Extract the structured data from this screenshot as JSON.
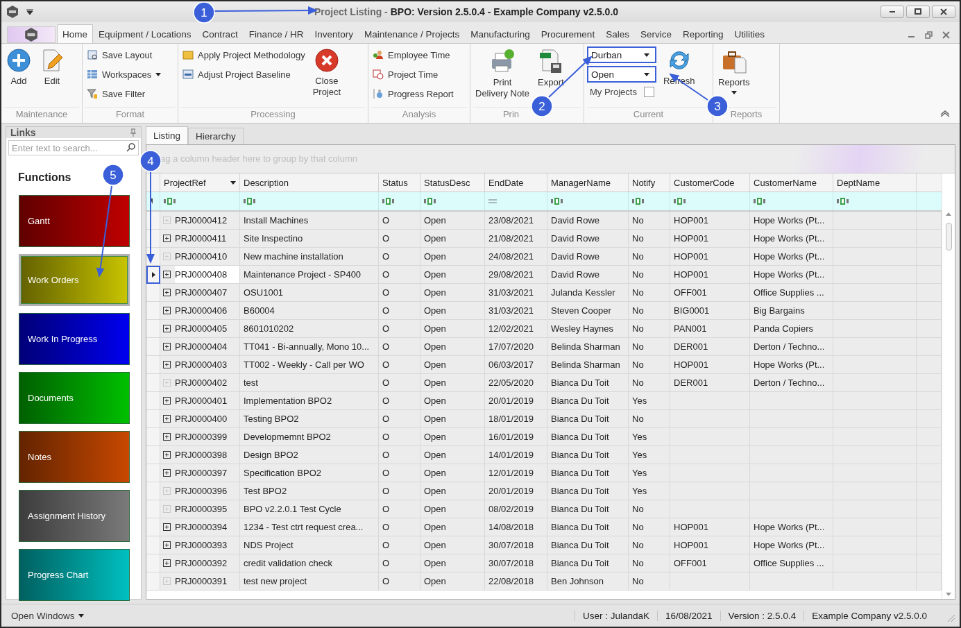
{
  "window": {
    "title": "Project Listing - **BPO: Version 2.5.0.4 - Example Company v2.5.0.0**"
  },
  "ribbon_tabs": [
    {
      "label": "Home",
      "selected": true
    },
    {
      "label": "Equipment / Locations",
      "selected": false
    },
    {
      "label": "Contract",
      "selected": false
    },
    {
      "label": "Finance / HR",
      "selected": false
    },
    {
      "label": "Inventory",
      "selected": false
    },
    {
      "label": "Maintenance / Projects",
      "selected": false
    },
    {
      "label": "Manufacturing",
      "selected": false
    },
    {
      "label": "Procurement",
      "selected": false
    },
    {
      "label": "Sales",
      "selected": false
    },
    {
      "label": "Service",
      "selected": false
    },
    {
      "label": "Reporting",
      "selected": false
    },
    {
      "label": "Utilities",
      "selected": false
    }
  ],
  "ribbon_groups": [
    {
      "label": "Maintenance",
      "items": [
        {
          "kind": "large",
          "label": "Add"
        },
        {
          "kind": "large",
          "label": "Edit"
        }
      ]
    },
    {
      "label": "Format",
      "items": [
        {
          "kind": "small",
          "label": "Save Layout"
        },
        {
          "kind": "small",
          "label": "Workspaces",
          "dropdown": true
        },
        {
          "kind": "small",
          "label": "Save Filter"
        }
      ]
    },
    {
      "label": "Processing",
      "items": [
        {
          "kind": "small",
          "label": "Apply Project Methodology"
        },
        {
          "kind": "small",
          "label": "Adjust Project Baseline"
        },
        {
          "kind": "large",
          "label": "Close\nProject"
        }
      ]
    },
    {
      "label": "Analysis",
      "items": [
        {
          "kind": "small",
          "label": "Employee Time"
        },
        {
          "kind": "small",
          "label": "Project Time"
        },
        {
          "kind": "small",
          "label": "Progress Report"
        }
      ]
    },
    {
      "label": "Prin",
      "items": [
        {
          "kind": "large",
          "label": "Print\nDelivery Note"
        },
        {
          "kind": "large",
          "label": "Export"
        }
      ]
    },
    {
      "label": "Current",
      "items": [
        {
          "kind": "combo",
          "value": "Durban",
          "highlighted": true
        },
        {
          "kind": "combo",
          "value": "Open",
          "highlighted": true
        },
        {
          "kind": "check",
          "label": "My Projects",
          "checked": false
        },
        {
          "kind": "large",
          "label": "Refresh"
        }
      ]
    },
    {
      "label": "Reports",
      "items": [
        {
          "kind": "large",
          "label": "Reports",
          "dropdown": true
        }
      ]
    }
  ],
  "links": {
    "title": "Links",
    "search": {
      "placeholder": "Enter text to search..."
    },
    "functions_title": "Functions",
    "tiles": [
      {
        "label": "Gantt",
        "color": "#c00000",
        "selected": false
      },
      {
        "label": "Work Orders",
        "color": "#c8c400",
        "selected": true
      },
      {
        "label": "Work In Progress",
        "color": "#0000f0",
        "selected": false
      },
      {
        "label": "Documents",
        "color": "#00c000",
        "selected": false
      },
      {
        "label": "Notes",
        "color": "#c84800",
        "selected": false
      },
      {
        "label": "Assignment History",
        "color": "#7a7a7a",
        "selected": false
      },
      {
        "label": "Progress Chart",
        "color": "#00c0c0",
        "selected": false
      }
    ]
  },
  "view_tabs": [
    {
      "label": "Listing",
      "selected": true
    },
    {
      "label": "Hierarchy",
      "selected": false
    }
  ],
  "group_panel": "ag a column header here to group by that column",
  "table": {
    "columns": [
      {
        "label": "ProjectRef",
        "kind": "text",
        "dropdown": true
      },
      {
        "label": "Description",
        "kind": "text",
        "dropdown": false
      },
      {
        "label": "Status",
        "kind": "text",
        "dropdown": false
      },
      {
        "label": "StatusDesc",
        "kind": "text",
        "dropdown": false
      },
      {
        "label": "EndDate",
        "kind": "date",
        "dropdown": false
      },
      {
        "label": "ManagerName",
        "kind": "text",
        "dropdown": false
      },
      {
        "label": "Notify",
        "kind": "text",
        "dropdown": false
      },
      {
        "label": "CustomerCode",
        "kind": "text",
        "dropdown": false
      },
      {
        "label": "CustomerName",
        "kind": "text",
        "dropdown": false
      },
      {
        "label": "DeptName",
        "kind": "text",
        "dropdown": false
      }
    ],
    "rows": [
      {
        "cells": [
          "PRJ0000412",
          "Install Machines",
          "O",
          "Open",
          "23/08/2021",
          "David Rowe",
          "No",
          "HOP001",
          "Hope Works (Pt..."
        ],
        "expandable": false,
        "selected": false,
        "highlighted": false
      },
      {
        "cells": [
          "PRJ0000411",
          "Site Inspectino",
          "O",
          "Open",
          "21/08/2021",
          "David Rowe",
          "No",
          "HOP001",
          "Hope Works (Pt..."
        ],
        "expandable": true,
        "selected": false,
        "highlighted": false
      },
      {
        "cells": [
          "PRJ0000410",
          "New machine installation",
          "O",
          "Open",
          "24/08/2021",
          "David Rowe",
          "No",
          "HOP001",
          "Hope Works (Pt..."
        ],
        "expandable": false,
        "selected": false,
        "highlighted": false
      },
      {
        "cells": [
          "PRJ0000408",
          "Maintenance Project - SP400",
          "O",
          "Open",
          "29/08/2021",
          "David Rowe",
          "No",
          "HOP001",
          "Hope Works (Pt..."
        ],
        "expandable": true,
        "selected": true,
        "highlighted": true
      },
      {
        "cells": [
          "PRJ0000407",
          "OSU1001",
          "O",
          "Open",
          "31/03/2021",
          "Julanda Kessler",
          "No",
          "OFF001",
          "Office Supplies ..."
        ],
        "expandable": true,
        "selected": false,
        "highlighted": false
      },
      {
        "cells": [
          "PRJ0000406",
          "B60004",
          "O",
          "Open",
          "31/03/2021",
          "Steven Cooper",
          "No",
          "BIG0001",
          "Big Bargains"
        ],
        "expandable": true,
        "selected": false,
        "highlighted": false
      },
      {
        "cells": [
          "PRJ0000405",
          "8601010202",
          "O",
          "Open",
          "12/02/2021",
          "Wesley Haynes",
          "No",
          "PAN001",
          "Panda Copiers"
        ],
        "expandable": true,
        "selected": false,
        "highlighted": false
      },
      {
        "cells": [
          "PRJ0000404",
          "TT041 - Bi-annually, Mono 10...",
          "O",
          "Open",
          "17/07/2020",
          "Belinda Sharman",
          "No",
          "DER001",
          "Derton / Techno..."
        ],
        "expandable": true,
        "selected": false,
        "highlighted": false
      },
      {
        "cells": [
          "PRJ0000403",
          "TT002 - Weekly - Call per WO",
          "O",
          "Open",
          "06/03/2017",
          "Belinda Sharman",
          "No",
          "HOP001",
          "Hope Works (Pt..."
        ],
        "expandable": true,
        "selected": false,
        "highlighted": false
      },
      {
        "cells": [
          "PRJ0000402",
          "test",
          "O",
          "Open",
          "22/05/2020",
          "Bianca Du Toit",
          "No",
          "DER001",
          "Derton / Techno..."
        ],
        "expandable": false,
        "selected": false,
        "highlighted": false
      },
      {
        "cells": [
          "PRJ0000401",
          "Implementation BPO2",
          "O",
          "Open",
          "20/01/2019",
          "Bianca Du Toit",
          "Yes"
        ],
        "expandable": true,
        "selected": false,
        "highlighted": false
      },
      {
        "cells": [
          "PRJ0000400",
          "Testing BPO2",
          "O",
          "Open",
          "18/01/2019",
          "Bianca Du Toit",
          "No"
        ],
        "expandable": true,
        "selected": false,
        "highlighted": false
      },
      {
        "cells": [
          "PRJ0000399",
          "Developmemnt BPO2",
          "O",
          "Open",
          "16/01/2019",
          "Bianca Du Toit",
          "Yes"
        ],
        "expandable": true,
        "selected": false,
        "highlighted": false
      },
      {
        "cells": [
          "PRJ0000398",
          "Design BPO2",
          "O",
          "Open",
          "14/01/2019",
          "Bianca Du Toit",
          "Yes"
        ],
        "expandable": true,
        "selected": false,
        "highlighted": false
      },
      {
        "cells": [
          "PRJ0000397",
          "Specification BPO2",
          "O",
          "Open",
          "12/01/2019",
          "Bianca Du Toit",
          "Yes"
        ],
        "expandable": true,
        "selected": false,
        "highlighted": false
      },
      {
        "cells": [
          "PRJ0000396",
          "Test BPO2",
          "O",
          "Open",
          "20/01/2019",
          "Bianca Du Toit",
          "Yes"
        ],
        "expandable": false,
        "selected": false,
        "highlighted": false
      },
      {
        "cells": [
          "PRJ0000395",
          "BPO v2.2.0.1 Test Cycle",
          "O",
          "Open",
          "08/02/2019",
          "Bianca Du Toit",
          "No"
        ],
        "expandable": false,
        "selected": false,
        "highlighted": false
      },
      {
        "cells": [
          "PRJ0000394",
          "1234 - Test ctrt request crea...",
          "O",
          "Open",
          "14/08/2018",
          "Bianca Du Toit",
          "No",
          "HOP001",
          "Hope Works (Pt..."
        ],
        "expandable": true,
        "selected": false,
        "highlighted": false
      },
      {
        "cells": [
          "PRJ0000393",
          "NDS Project",
          "O",
          "Open",
          "30/07/2018",
          "Bianca Du Toit",
          "No",
          "HOP001",
          "Hope Works (Pt..."
        ],
        "expandable": true,
        "selected": false,
        "highlighted": false
      },
      {
        "cells": [
          "PRJ0000392",
          "credit validation check",
          "O",
          "Open",
          "30/07/2018",
          "Bianca Du Toit",
          "No",
          "OFF001",
          "Office Supplies ..."
        ],
        "expandable": true,
        "selected": false,
        "highlighted": false
      },
      {
        "cells": [
          "PRJ0000391",
          "test new project",
          "O",
          "Open",
          "22/08/2018",
          "Ben Johnson",
          "No"
        ],
        "expandable": false,
        "selected": false,
        "highlighted": false
      }
    ]
  },
  "status_bar": {
    "open_windows": "Open Windows",
    "items": [
      "User : JulandaK",
      "16/08/2021",
      "Version : 2.5.0.4",
      "Example Company v2.5.0.0"
    ]
  },
  "callouts": [
    {
      "number": "1"
    },
    {
      "number": "2"
    },
    {
      "number": "3"
    },
    {
      "number": "4"
    },
    {
      "number": "5"
    }
  ]
}
